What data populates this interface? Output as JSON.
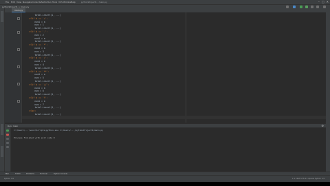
{
  "window": {
    "menu_items": [
      "File",
      "Edit",
      "View",
      "Navigate",
      "Code",
      "Refactor",
      "Run",
      "Tools",
      "VCS",
      "Window",
      "Help"
    ],
    "title": "pythonProject1 - main.py",
    "minimize_icon": "minimize-icon",
    "maximize_icon": "maximize-icon",
    "close_icon": "close-icon"
  },
  "navbar": {
    "breadcrumb": "pythonProject1 > main.py"
  },
  "editor": {
    "tab_label": "main.py",
    "lines": [
      "        total.insert(1, ...)",
      "    elif b == '+':",
      "        num1 = a",
      "        num = 1",
      "        total.insert(1, ...)",
      "    elif b == '-':",
      "        num = 2",
      "        num1 = a",
      "        total.insert(1, ...)",
      "    elif b == '*':",
      "        num1 = a",
      "        num = 3",
      "        total.insert(1, ...)",
      "    elif b == '/':",
      "        num1 = a",
      "        num = 4",
      "        total.insert(1, ...)",
      "    elif b == '**':",
      "        num1 = a",
      "        num = 5",
      "        total.insert(1, ...)",
      "    elif b == '//':",
      "        num1 = a",
      "        num = 6",
      "        total.insert(1, ...)",
      "    elif b == '%':",
      "        num1 = a",
      "        num = 7",
      "        total.insert(1, ...)",
      "    else:",
      "        total.insert(1, ...)",
      ""
    ]
  },
  "run": {
    "header_label": "Run: main",
    "command": "C:\\Users\\...\\venv\\Scripts\\python.exe C:/Users/.../pythonProject1/main.py",
    "output": "Process finished with exit code 0"
  },
  "bottom_tabs": [
    "Run",
    "TODO",
    "Problems",
    "Terminal",
    "Python Console"
  ],
  "status": {
    "left": "Python 3.9",
    "right": "1:1  CRLF  UTF-8  4 spaces  Python 3.9"
  }
}
